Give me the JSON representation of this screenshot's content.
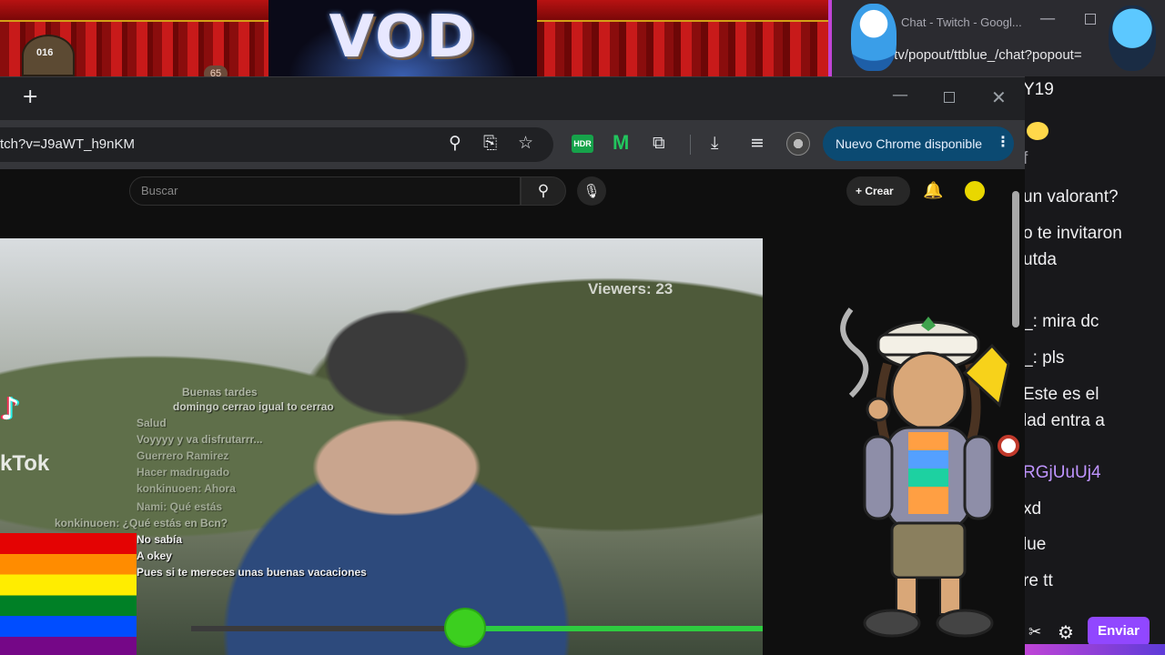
{
  "overlay": {
    "logo_text": "VOD",
    "cat_badge": "016",
    "counter": "65"
  },
  "twitch": {
    "tab_title": "Chat - Twitch - Googl...",
    "url": "tch.tv/popout/ttblue_/chat?popout=",
    "chat_lines": [
      {
        "text": "Y19"
      },
      {
        "text": "f"
      },
      {
        "text": "un valorant?"
      },
      {
        "text": "o te invitaron"
      },
      {
        "text": "utda"
      },
      {
        "text": "_: mira dc"
      },
      {
        "text": "_: pls"
      },
      {
        "text": "Este es el"
      },
      {
        "text": "lad entra a"
      },
      {
        "text": "RGjUuUj4"
      },
      {
        "text": "xd"
      },
      {
        "text": "lue"
      },
      {
        "text": "re tt"
      }
    ],
    "send_label": "Enviar"
  },
  "chrome": {
    "url": "tch?v=J9aWT_h9nKM",
    "update_label": "Nuevo Chrome disponible",
    "ext_1_label": "HDR",
    "ext_2_label": "M"
  },
  "youtube": {
    "search_placeholder": "Buscar",
    "create_label": "Crear"
  },
  "video": {
    "viewers_label": "Viewers: 23",
    "tiktok_word": "kTok",
    "overlay_lines": [
      "Buenas tardes",
      "domingo cerrao igual to cerrao",
      "Salud",
      "Voyyyy y va disfrutarrr...",
      "Guerrero Ramirez",
      "Hacer madrugado",
      "konkinuoen: Ahora",
      "Nami: Qué estás",
      "konkinuoen: ¿Qué estás en Bcn?",
      "No sabía",
      "A okey",
      "Pues si te mereces unas buenas vacaciones"
    ],
    "progress_fraction": 0.48
  }
}
